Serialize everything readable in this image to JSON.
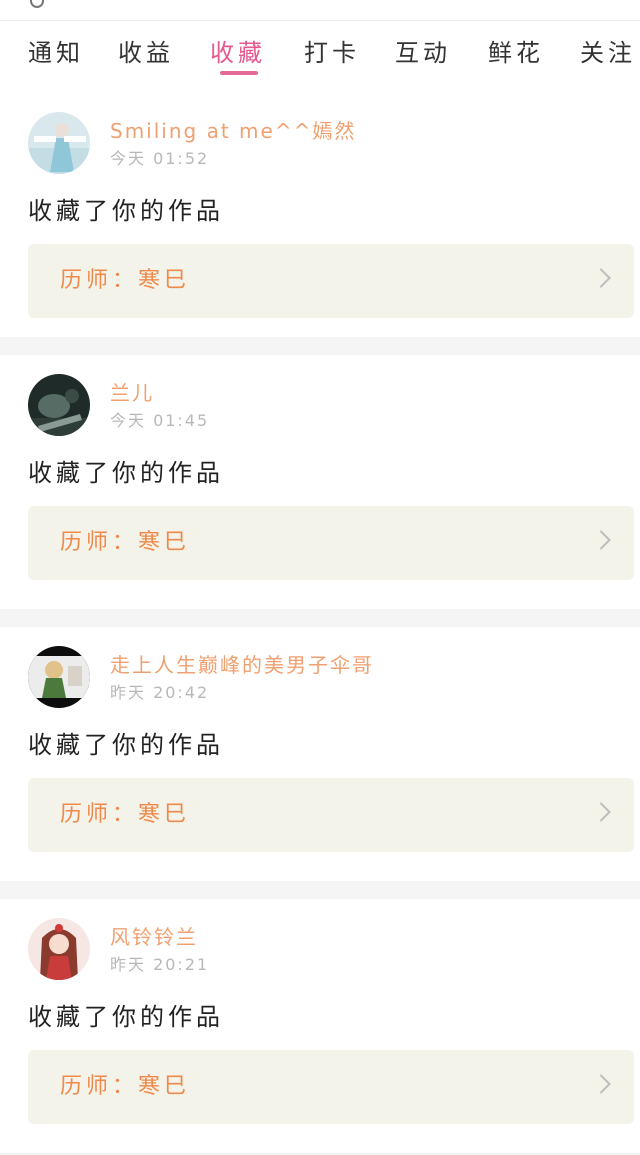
{
  "tabs": [
    {
      "label": "通知",
      "active": false
    },
    {
      "label": "收益",
      "active": false
    },
    {
      "label": "收藏",
      "active": true
    },
    {
      "label": "打卡",
      "active": false
    },
    {
      "label": "互动",
      "active": false
    },
    {
      "label": "鲜花",
      "active": false
    },
    {
      "label": "关注",
      "active": false
    }
  ],
  "notifications": [
    {
      "user": "Smiling at me^^嫣然",
      "time": "今天 01:52",
      "action": "收藏了你的作品",
      "work": "历师：寒巳",
      "avatar_icon": "avatar-girl-bluedress"
    },
    {
      "user": "兰儿",
      "time": "今天 01:45",
      "action": "收藏了你的作品",
      "work": "历师：寒巳",
      "avatar_icon": "avatar-dark-portrait"
    },
    {
      "user": "走上人生巅峰的美男子伞哥",
      "time": "昨天 20:42",
      "action": "收藏了你的作品",
      "work": "历师：寒巳",
      "avatar_icon": "avatar-boy-anime"
    },
    {
      "user": "风铃铃兰",
      "time": "昨天 20:21",
      "action": "收藏了你的作品",
      "work": "历师：寒巳",
      "avatar_icon": "avatar-girl-red"
    }
  ],
  "colors": {
    "accent": "#e5588f",
    "username": "#f0a070",
    "work_title": "#f08a4b",
    "work_bg": "#f3f3ea"
  }
}
